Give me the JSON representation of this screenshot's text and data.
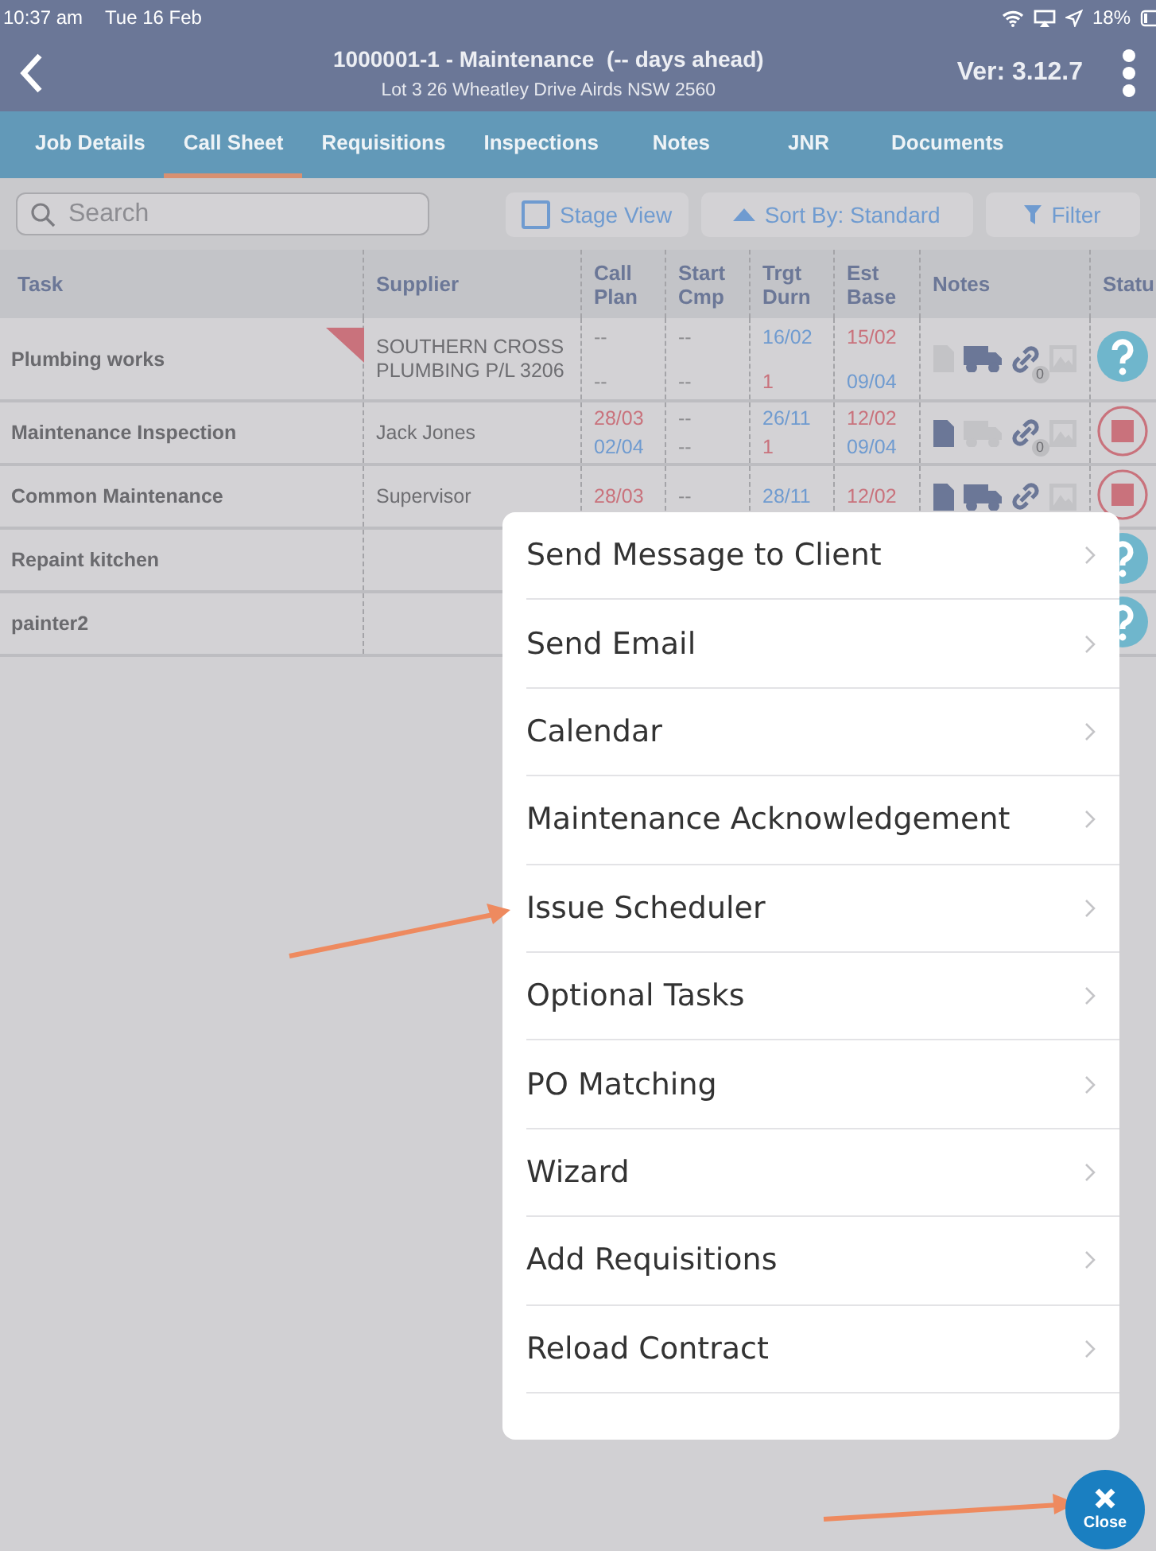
{
  "status_bar": {
    "time": "10:37 am",
    "date": "Tue 16 Feb",
    "battery": "18%"
  },
  "header": {
    "title": "1000001-1 - Maintenance  (-- days ahead)",
    "subtitle": "Lot 3 26 Wheatley Drive Airds NSW 2560",
    "version": "Ver: 3.12.7"
  },
  "tabs": [
    {
      "label": "Job Details",
      "selected": false
    },
    {
      "label": "Call Sheet",
      "selected": true
    },
    {
      "label": "Requisitions",
      "selected": false
    },
    {
      "label": "Inspections",
      "selected": false
    },
    {
      "label": "Notes",
      "selected": false
    },
    {
      "label": "JNR",
      "selected": false
    },
    {
      "label": "Documents",
      "selected": false
    }
  ],
  "toolbar": {
    "search_placeholder": "Search",
    "stage_view": {
      "label": "Stage View",
      "checked": false
    },
    "sort": "Sort By: Standard",
    "filter": "Filter"
  },
  "table": {
    "columns": [
      "Task",
      "Supplier",
      "Call Plan",
      "Start Cmp",
      "Trgt Durn",
      "Est Base",
      "Notes",
      "Statu"
    ],
    "rows": [
      {
        "task": "Plumbing works",
        "flagged": true,
        "supplier": "SOUTHERN CROSS PLUMBING P/L 3206",
        "dates": [
          [
            {
              "text": "--",
              "color": "#8c8c8f"
            },
            {
              "text": "--",
              "color": "#8c8c8f"
            }
          ],
          [
            {
              "text": "--",
              "color": "#8c8c8f"
            },
            {
              "text": "--",
              "color": "#8c8c8f"
            }
          ],
          [
            {
              "text": "16/02",
              "color": "#6f9bd0"
            },
            {
              "text": "1",
              "color": "#c9727c"
            }
          ],
          [
            {
              "text": "15/02",
              "color": "#c9727c"
            },
            {
              "text": "09/04",
              "color": "#6f9bd0"
            }
          ]
        ],
        "notes": {
          "document": false,
          "delivery": true,
          "link": true,
          "link_count": "0",
          "photo": false
        },
        "status": {
          "kind": "question"
        }
      },
      {
        "task": "Maintenance Inspection",
        "flagged": false,
        "supplier": "Jack Jones",
        "dates": [
          [
            {
              "text": "28/03",
              "color": "#c9727c"
            },
            {
              "text": "02/04",
              "color": "#6f9bd0"
            }
          ],
          [
            {
              "text": "--",
              "color": "#8c8c8f"
            },
            {
              "text": "--",
              "color": "#8c8c8f"
            }
          ],
          [
            {
              "text": "26/11",
              "color": "#6f9bd0"
            },
            {
              "text": "1",
              "color": "#c9727c"
            }
          ],
          [
            {
              "text": "12/02",
              "color": "#c9727c"
            },
            {
              "text": "09/04",
              "color": "#6f9bd0"
            }
          ]
        ],
        "notes": {
          "document": true,
          "delivery": false,
          "link": true,
          "link_count": "0",
          "photo": false
        },
        "status": {
          "kind": "stop"
        }
      },
      {
        "task": "Common Maintenance",
        "flagged": false,
        "supplier": "Supervisor",
        "dates": [
          [
            {
              "text": "28/03",
              "color": "#c9727c"
            }
          ],
          [
            {
              "text": "--",
              "color": "#8c8c8f"
            }
          ],
          [
            {
              "text": "28/11",
              "color": "#6f9bd0"
            }
          ],
          [
            {
              "text": "12/02",
              "color": "#c9727c"
            }
          ]
        ],
        "notes": {
          "document": true,
          "delivery": true,
          "link": true,
          "photo": false
        },
        "status": {
          "kind": "stop"
        }
      },
      {
        "task": "Repaint kitchen",
        "flagged": false,
        "status": {
          "kind": "question"
        }
      },
      {
        "task": "painter2",
        "flagged": false,
        "status": {
          "kind": "question"
        }
      }
    ]
  },
  "menu": [
    "Send Message to Client",
    "Send Email",
    "Calendar",
    "Maintenance Acknowledgement",
    "Issue Scheduler",
    "Optional Tasks",
    "PO Matching",
    "Wizard",
    "Add Requisitions",
    "Reload Contract"
  ],
  "close_button": "Close"
}
